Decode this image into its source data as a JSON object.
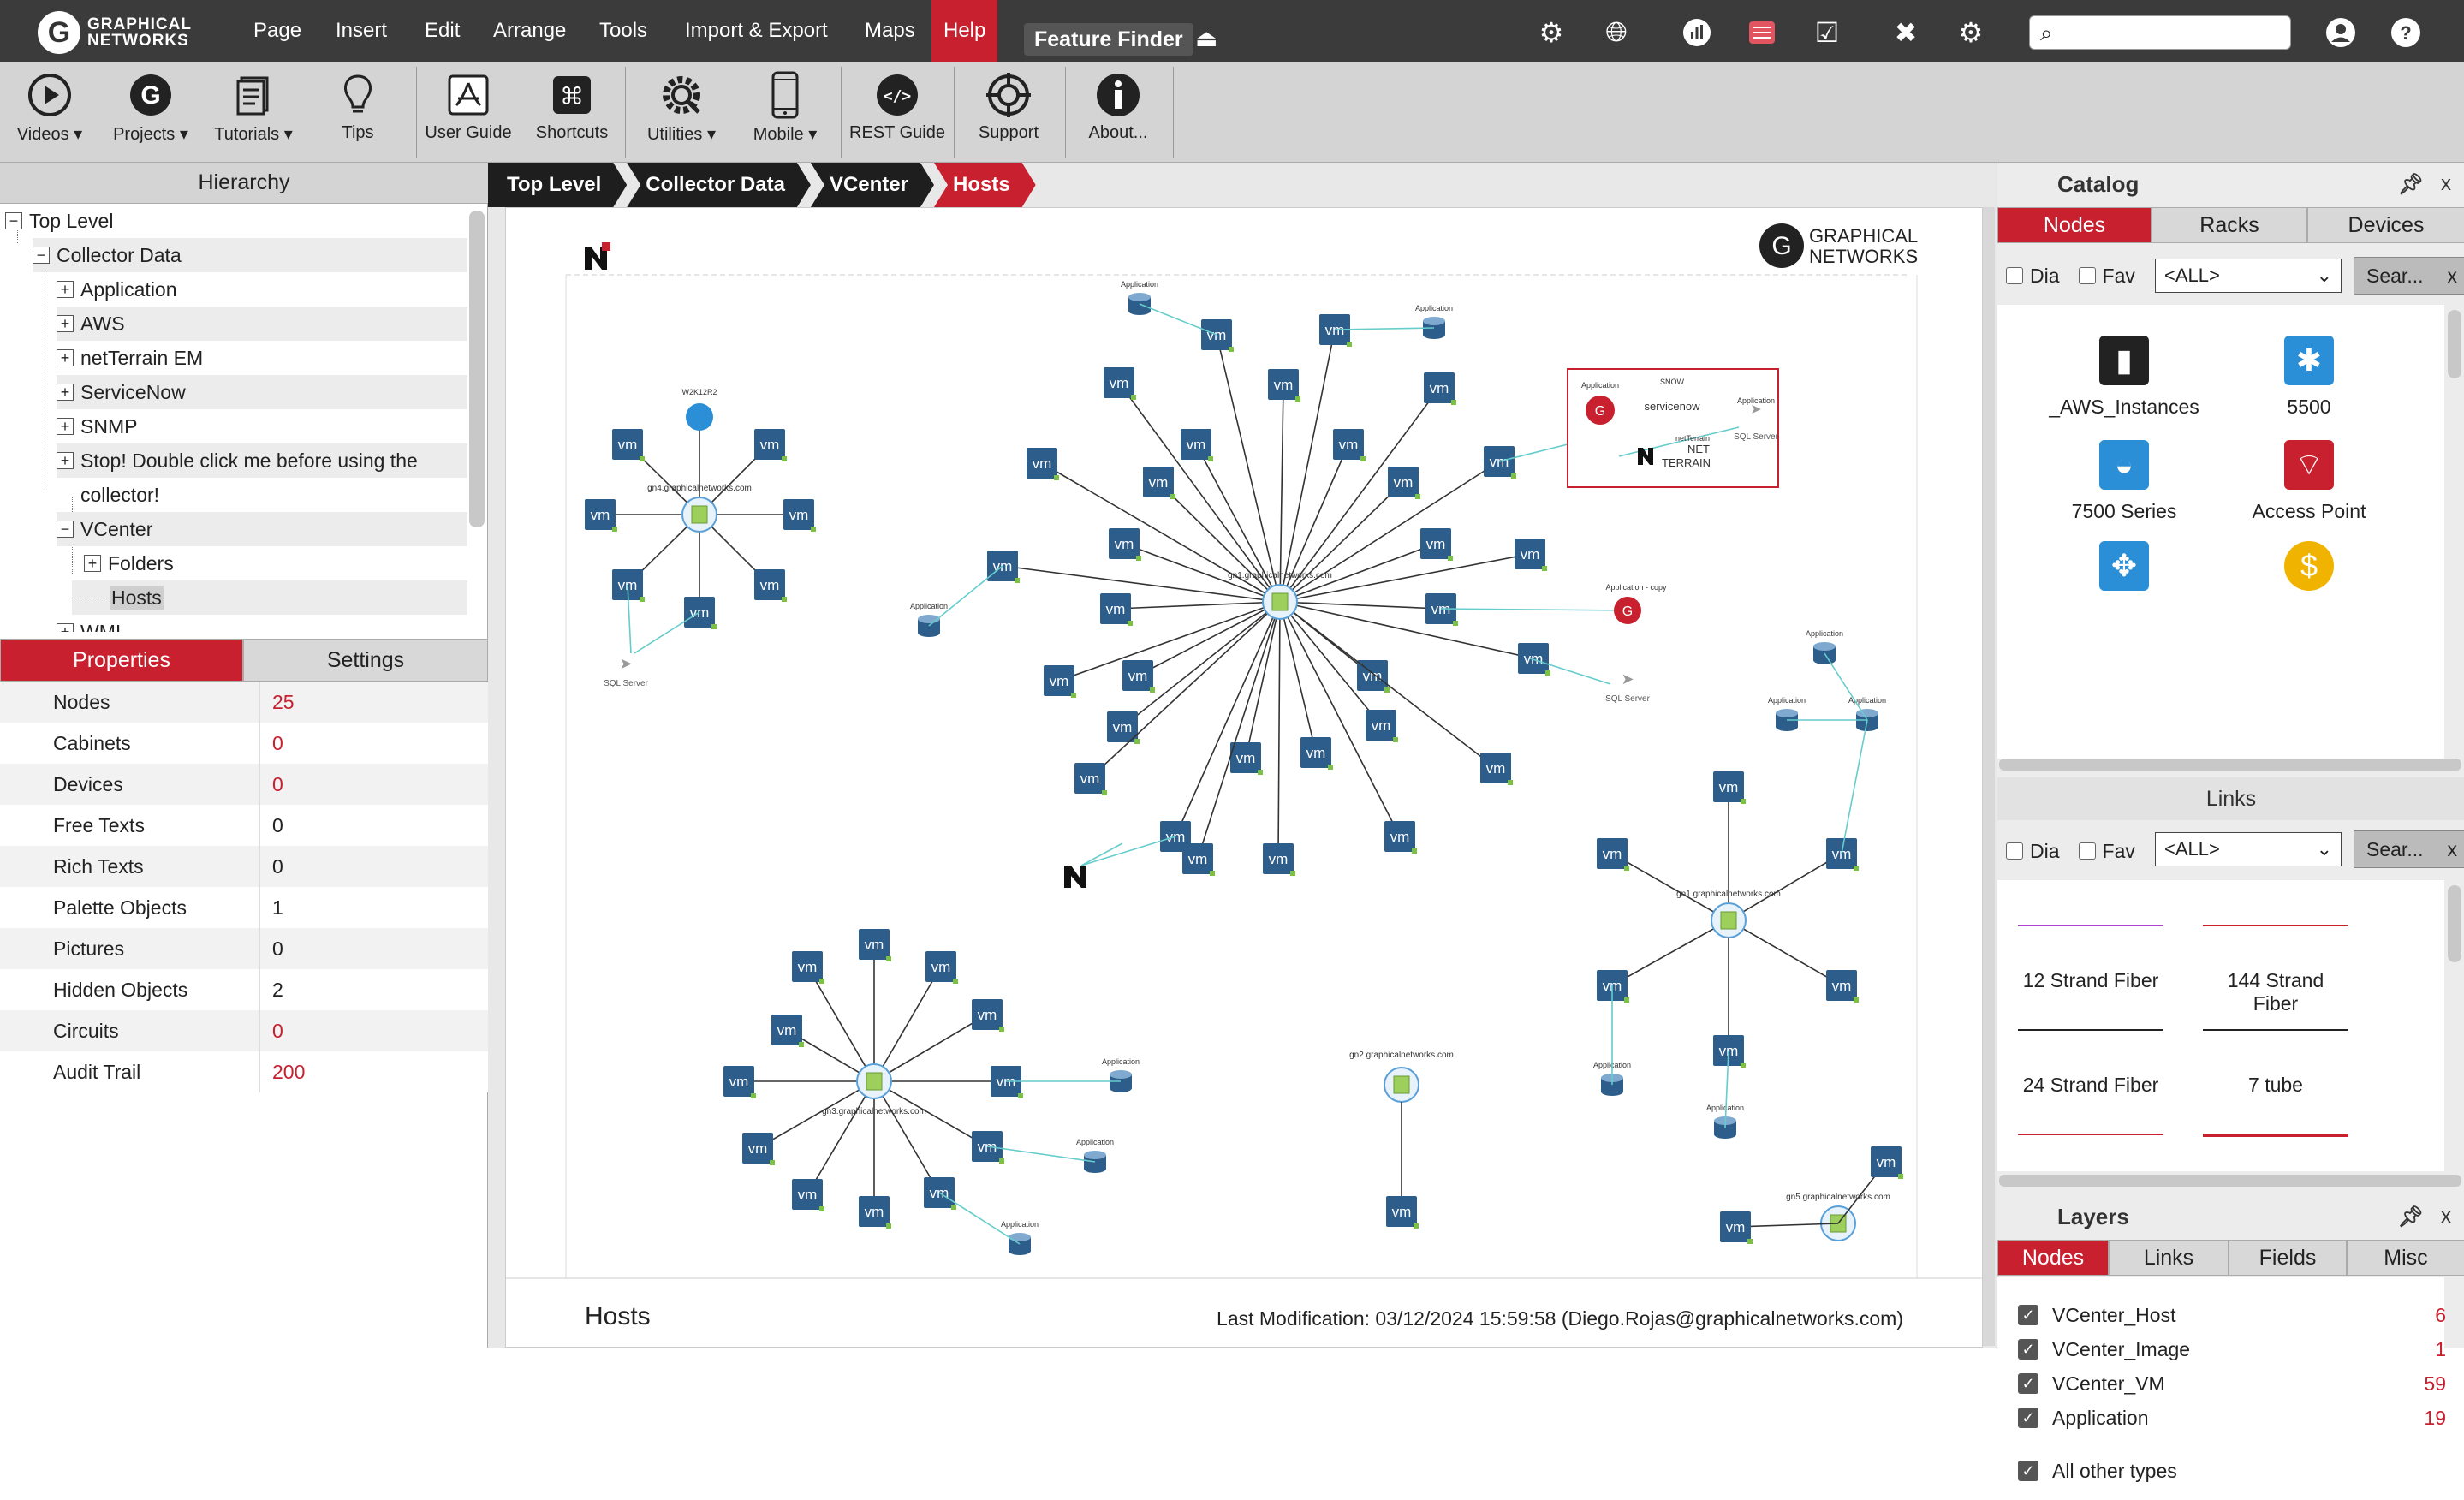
{
  "app": {
    "logo_text_1": "GRAPHICAL",
    "logo_text_2": "NETWORKS"
  },
  "menu": [
    {
      "label": "Page",
      "active": false
    },
    {
      "label": "Insert",
      "active": false
    },
    {
      "label": "Edit",
      "active": false
    },
    {
      "label": "Arrange",
      "active": false
    },
    {
      "label": "Tools",
      "active": false
    },
    {
      "label": "Import & Export",
      "active": false
    },
    {
      "label": "Maps",
      "active": false
    },
    {
      "label": "Help",
      "active": true
    }
  ],
  "feature_finder": "Feature Finder",
  "top_icons": [
    "ip-gear-icon",
    "globe-icon",
    "chart-icon",
    "report-icon",
    "checkbox-icon",
    "tools-icon",
    "settings-icon"
  ],
  "search": {
    "placeholder": ""
  },
  "ribbon": [
    {
      "label": "Videos",
      "icon": "play-icon",
      "dropdown": true
    },
    {
      "label": "Projects",
      "icon": "g-logo-icon",
      "dropdown": true
    },
    {
      "label": "Tutorials",
      "icon": "document-icon",
      "dropdown": true
    },
    {
      "label": "Tips",
      "icon": "lightbulb-icon",
      "dropdown": false
    },
    {
      "label": "User Guide",
      "icon": "pdf-icon",
      "dropdown": false
    },
    {
      "label": "Shortcuts",
      "icon": "command-icon",
      "dropdown": false
    },
    {
      "label": "Utilities",
      "icon": "gear-wrench-icon",
      "dropdown": true
    },
    {
      "label": "Mobile",
      "icon": "mobile-icon",
      "dropdown": true
    },
    {
      "label": "REST Guide",
      "icon": "code-icon",
      "dropdown": false
    },
    {
      "label": "Support",
      "icon": "lifebuoy-icon",
      "dropdown": false
    },
    {
      "label": "About...",
      "icon": "info-icon",
      "dropdown": false
    }
  ],
  "hierarchy": {
    "title": "Hierarchy",
    "items": [
      {
        "label": "Top Level",
        "level": 0,
        "toggle": "−"
      },
      {
        "label": "Collector Data",
        "level": 1,
        "toggle": "−"
      },
      {
        "label": "Application",
        "level": 2,
        "toggle": "+"
      },
      {
        "label": "AWS",
        "level": 2,
        "toggle": "+"
      },
      {
        "label": "netTerrain EM",
        "level": 2,
        "toggle": "+"
      },
      {
        "label": "ServiceNow",
        "level": 2,
        "toggle": "+"
      },
      {
        "label": "SNMP",
        "level": 2,
        "toggle": "+"
      },
      {
        "label": "Stop! Double click me before using the",
        "level": 2,
        "toggle": "+"
      },
      {
        "label": "collector!",
        "level": 2,
        "toggle": ""
      },
      {
        "label": "VCenter",
        "level": 2,
        "toggle": "−"
      },
      {
        "label": "Folders",
        "level": 3,
        "toggle": "+"
      },
      {
        "label": "Hosts",
        "level": 3,
        "toggle": ""
      },
      {
        "label": "WMI",
        "level": 2,
        "toggle": "+"
      }
    ]
  },
  "props_tabs": [
    "Properties",
    "Settings"
  ],
  "properties": [
    {
      "key": "Nodes",
      "value": "25",
      "red": true
    },
    {
      "key": "Cabinets",
      "value": "0",
      "red": true
    },
    {
      "key": "Devices",
      "value": "0",
      "red": true
    },
    {
      "key": "Free Texts",
      "value": "0",
      "red": false
    },
    {
      "key": "Rich Texts",
      "value": "0",
      "red": false
    },
    {
      "key": "Palette Objects",
      "value": "1",
      "red": false
    },
    {
      "key": "Pictures",
      "value": "0",
      "red": false
    },
    {
      "key": "Hidden Objects",
      "value": "2",
      "red": false
    },
    {
      "key": "Circuits",
      "value": "0",
      "red": true
    },
    {
      "key": "Audit Trail",
      "value": "200",
      "red": true
    }
  ],
  "breadcrumbs": [
    "Top Level",
    "Collector Data",
    "VCenter",
    "Hosts"
  ],
  "diagram": {
    "brand_text_1": "GRAPHICAL",
    "brand_text_2": "NETWORKS",
    "vm_label": "vm",
    "host_labels": {
      "gn4": "gn4.graphicalnetworks.com",
      "main": "gn1.graphicalnetworks.com",
      "gn3": "gn3.graphicalnetworks.com",
      "gn2": "gn2.graphicalnetworks.com",
      "gn1": "gn1.graphicalnetworks.com",
      "gn5": "gn5.graphicalnetworks.com"
    },
    "app_label": "Application",
    "app_copy_label": "Application - copy",
    "sql_label": "SQL Server",
    "win_label": "W2K12R2",
    "snow_label": "SNOW",
    "servicenow_label": "servicenow",
    "netterrain_label_1": "NET",
    "netterrain_label_2": "TERRAIN",
    "netterrain_small": "netTerrain"
  },
  "footer": {
    "title": "Hosts",
    "modification": "Last Modification: 03/12/2024 15:59:58 (Diego.Rojas@graphicalnetworks.com)"
  },
  "catalog": {
    "title": "Catalog",
    "tabs": [
      "Nodes",
      "Racks",
      "Devices"
    ],
    "dia": "Dia",
    "fav": "Fav",
    "select": "<ALL>",
    "search_btn": "Sear...",
    "close": "x",
    "items": [
      {
        "label": "_AWS_Instances",
        "icon": "server-icon",
        "color": "#222222"
      },
      {
        "label": "5500",
        "icon": "switch-star-icon",
        "color": "#2a8fd6"
      },
      {
        "label": "7500 Series",
        "icon": "router-icon",
        "color": "#2a8fd6"
      },
      {
        "label": "Access Point",
        "icon": "wifi-router-icon",
        "color": "#c8202f"
      },
      {
        "label": "",
        "icon": "arrows-switch-icon",
        "color": "#2a8fd6"
      },
      {
        "label": "",
        "icon": "dollar-icon",
        "color": "#f0b400"
      }
    ]
  },
  "links": {
    "title": "Links",
    "dia": "Dia",
    "fav": "Fav",
    "select": "<ALL>",
    "search_btn": "Sear...",
    "close": "x",
    "items": [
      {
        "label": "12 Strand Fiber",
        "color": "#b040d0"
      },
      {
        "label": "144 Strand Fiber",
        "color": "#c8202f"
      },
      {
        "label": "24 Strand Fiber",
        "color": "#222222"
      },
      {
        "label": "7 tube",
        "color": "#222222"
      }
    ]
  },
  "layers": {
    "title": "Layers",
    "tabs": [
      "Nodes",
      "Links",
      "Fields",
      "Misc"
    ],
    "rows": [
      {
        "label": "VCenter_Host",
        "count": "6"
      },
      {
        "label": "VCenter_Image",
        "count": "1"
      },
      {
        "label": "VCenter_VM",
        "count": "59"
      },
      {
        "label": "Application",
        "count": "19"
      },
      {
        "label": "All other types",
        "count": ""
      }
    ]
  }
}
